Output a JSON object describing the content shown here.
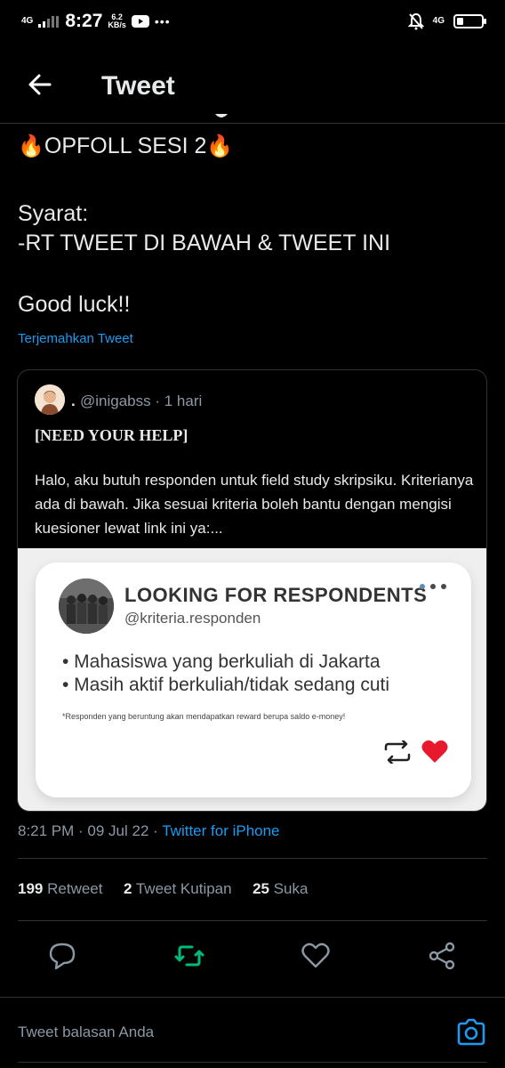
{
  "status_bar": {
    "network_left": "4G",
    "time": "8:27",
    "speed_value": "6.2",
    "speed_unit": "KB/s",
    "dots": "•••",
    "network_right": "4G",
    "battery_level": 0.25
  },
  "header": {
    "title": "Tweet"
  },
  "tweet": {
    "line1": "OPFOLL SESI 2",
    "line2": "Syarat:",
    "line3": "-RT TWEET DI BAWAH & TWEET INI",
    "line4": "Good luck!!",
    "translate_label": "Terjemahkan Tweet"
  },
  "quote": {
    "name": ".",
    "handle_time": "@inigabss · 1 hari",
    "heading": "[NEED YOUR HELP]",
    "body": "Halo, aku butuh responden untuk field study skripsiku. Kriterianya ada di bawah. Jika sesuai kriteria boleh bantu dengan mengisi kuesioner lewat link ini ya:...",
    "image": {
      "title": "LOOKING FOR RESPONDENTS",
      "handle": "@kriteria.responden",
      "bullet1": "• Mahasiswa yang berkuliah di Jakarta",
      "bullet2": "• Masih aktif berkuliah/tidak sedang cuti",
      "note": "*Responden yang beruntung akan mendapatkan reward berupa saldo e-money!"
    }
  },
  "meta": {
    "time": "8:21 PM",
    "sep": " · ",
    "date": "09 Jul 22",
    "sep2": " · ",
    "source": "Twitter for iPhone"
  },
  "stats": {
    "retweets_count": "199",
    "retweets_label": "Retweet",
    "quotes_count": "2",
    "quotes_label": "Tweet Kutipan",
    "likes_count": "25",
    "likes_label": "Suka"
  },
  "reply": {
    "placeholder": "Tweet balasan Anda"
  },
  "colors": {
    "background": "#000000",
    "accent": "#1d9bf0",
    "retweet_active": "#00ba7c",
    "heart": "#e0245e"
  }
}
